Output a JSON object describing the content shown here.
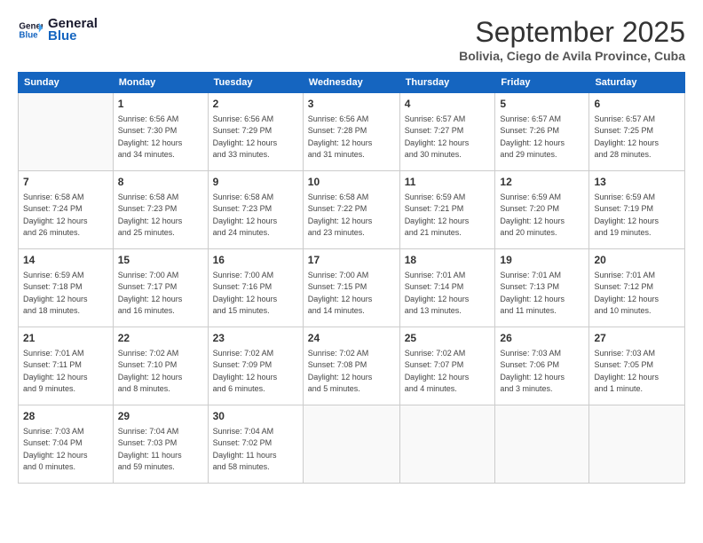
{
  "header": {
    "logo_line1": "General",
    "logo_line2": "Blue",
    "main_title": "September 2025",
    "subtitle": "Bolivia, Ciego de Avila Province, Cuba"
  },
  "calendar": {
    "days_of_week": [
      "Sunday",
      "Monday",
      "Tuesday",
      "Wednesday",
      "Thursday",
      "Friday",
      "Saturday"
    ],
    "weeks": [
      [
        {
          "day": "",
          "info": ""
        },
        {
          "day": "1",
          "info": "Sunrise: 6:56 AM\nSunset: 7:30 PM\nDaylight: 12 hours\nand 34 minutes."
        },
        {
          "day": "2",
          "info": "Sunrise: 6:56 AM\nSunset: 7:29 PM\nDaylight: 12 hours\nand 33 minutes."
        },
        {
          "day": "3",
          "info": "Sunrise: 6:56 AM\nSunset: 7:28 PM\nDaylight: 12 hours\nand 31 minutes."
        },
        {
          "day": "4",
          "info": "Sunrise: 6:57 AM\nSunset: 7:27 PM\nDaylight: 12 hours\nand 30 minutes."
        },
        {
          "day": "5",
          "info": "Sunrise: 6:57 AM\nSunset: 7:26 PM\nDaylight: 12 hours\nand 29 minutes."
        },
        {
          "day": "6",
          "info": "Sunrise: 6:57 AM\nSunset: 7:25 PM\nDaylight: 12 hours\nand 28 minutes."
        }
      ],
      [
        {
          "day": "7",
          "info": "Sunrise: 6:58 AM\nSunset: 7:24 PM\nDaylight: 12 hours\nand 26 minutes."
        },
        {
          "day": "8",
          "info": "Sunrise: 6:58 AM\nSunset: 7:23 PM\nDaylight: 12 hours\nand 25 minutes."
        },
        {
          "day": "9",
          "info": "Sunrise: 6:58 AM\nSunset: 7:23 PM\nDaylight: 12 hours\nand 24 minutes."
        },
        {
          "day": "10",
          "info": "Sunrise: 6:58 AM\nSunset: 7:22 PM\nDaylight: 12 hours\nand 23 minutes."
        },
        {
          "day": "11",
          "info": "Sunrise: 6:59 AM\nSunset: 7:21 PM\nDaylight: 12 hours\nand 21 minutes."
        },
        {
          "day": "12",
          "info": "Sunrise: 6:59 AM\nSunset: 7:20 PM\nDaylight: 12 hours\nand 20 minutes."
        },
        {
          "day": "13",
          "info": "Sunrise: 6:59 AM\nSunset: 7:19 PM\nDaylight: 12 hours\nand 19 minutes."
        }
      ],
      [
        {
          "day": "14",
          "info": "Sunrise: 6:59 AM\nSunset: 7:18 PM\nDaylight: 12 hours\nand 18 minutes."
        },
        {
          "day": "15",
          "info": "Sunrise: 7:00 AM\nSunset: 7:17 PM\nDaylight: 12 hours\nand 16 minutes."
        },
        {
          "day": "16",
          "info": "Sunrise: 7:00 AM\nSunset: 7:16 PM\nDaylight: 12 hours\nand 15 minutes."
        },
        {
          "day": "17",
          "info": "Sunrise: 7:00 AM\nSunset: 7:15 PM\nDaylight: 12 hours\nand 14 minutes."
        },
        {
          "day": "18",
          "info": "Sunrise: 7:01 AM\nSunset: 7:14 PM\nDaylight: 12 hours\nand 13 minutes."
        },
        {
          "day": "19",
          "info": "Sunrise: 7:01 AM\nSunset: 7:13 PM\nDaylight: 12 hours\nand 11 minutes."
        },
        {
          "day": "20",
          "info": "Sunrise: 7:01 AM\nSunset: 7:12 PM\nDaylight: 12 hours\nand 10 minutes."
        }
      ],
      [
        {
          "day": "21",
          "info": "Sunrise: 7:01 AM\nSunset: 7:11 PM\nDaylight: 12 hours\nand 9 minutes."
        },
        {
          "day": "22",
          "info": "Sunrise: 7:02 AM\nSunset: 7:10 PM\nDaylight: 12 hours\nand 8 minutes."
        },
        {
          "day": "23",
          "info": "Sunrise: 7:02 AM\nSunset: 7:09 PM\nDaylight: 12 hours\nand 6 minutes."
        },
        {
          "day": "24",
          "info": "Sunrise: 7:02 AM\nSunset: 7:08 PM\nDaylight: 12 hours\nand 5 minutes."
        },
        {
          "day": "25",
          "info": "Sunrise: 7:02 AM\nSunset: 7:07 PM\nDaylight: 12 hours\nand 4 minutes."
        },
        {
          "day": "26",
          "info": "Sunrise: 7:03 AM\nSunset: 7:06 PM\nDaylight: 12 hours\nand 3 minutes."
        },
        {
          "day": "27",
          "info": "Sunrise: 7:03 AM\nSunset: 7:05 PM\nDaylight: 12 hours\nand 1 minute."
        }
      ],
      [
        {
          "day": "28",
          "info": "Sunrise: 7:03 AM\nSunset: 7:04 PM\nDaylight: 12 hours\nand 0 minutes."
        },
        {
          "day": "29",
          "info": "Sunrise: 7:04 AM\nSunset: 7:03 PM\nDaylight: 11 hours\nand 59 minutes."
        },
        {
          "day": "30",
          "info": "Sunrise: 7:04 AM\nSunset: 7:02 PM\nDaylight: 11 hours\nand 58 minutes."
        },
        {
          "day": "",
          "info": ""
        },
        {
          "day": "",
          "info": ""
        },
        {
          "day": "",
          "info": ""
        },
        {
          "day": "",
          "info": ""
        }
      ]
    ]
  }
}
